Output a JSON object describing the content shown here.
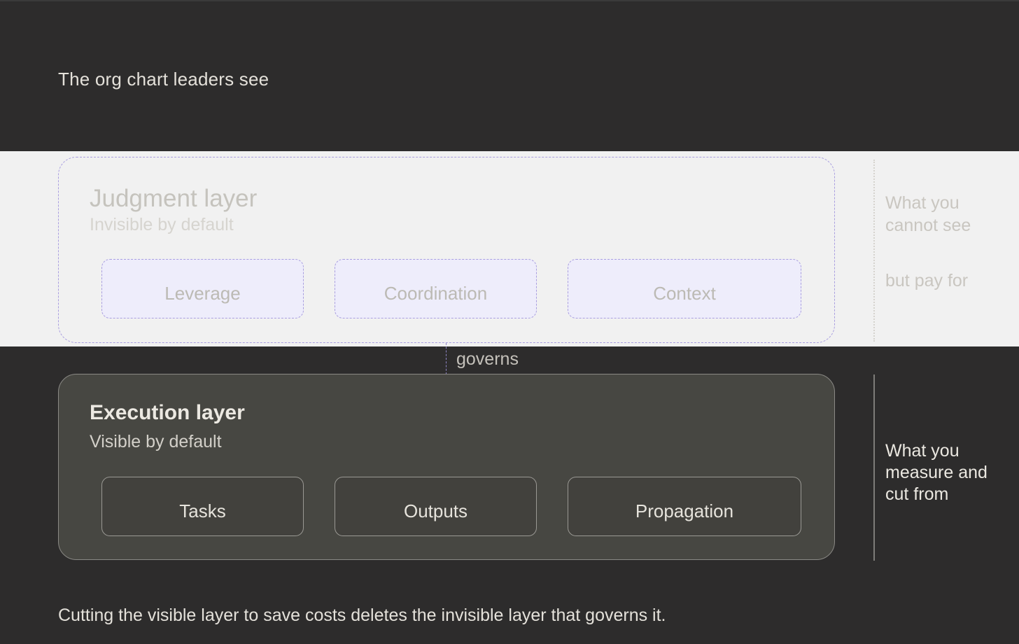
{
  "heading": "The org chart leaders see",
  "judgment": {
    "title": "Judgment layer",
    "subtitle": "Invisible by default",
    "items": [
      "Leverage",
      "Coordination",
      "Context"
    ],
    "side_label_top": "What you\ncannot see",
    "side_label_bottom": "but pay for"
  },
  "connector_label": "governs",
  "execution": {
    "title": "Execution layer",
    "subtitle": "Visible by default",
    "items": [
      "Tasks",
      "Outputs",
      "Propagation"
    ],
    "side_label": "What you\nmeasure and\ncut from"
  },
  "footer": "Cutting the visible layer to save costs deletes the invisible layer that governs it.",
  "colors": {
    "background_dark": "#2d2c2c",
    "band_light": "#f1f1f1",
    "judgment_border": "#a99ee0",
    "judgment_pill_fill": "#eeedfb",
    "execution_fill": "#474742"
  }
}
